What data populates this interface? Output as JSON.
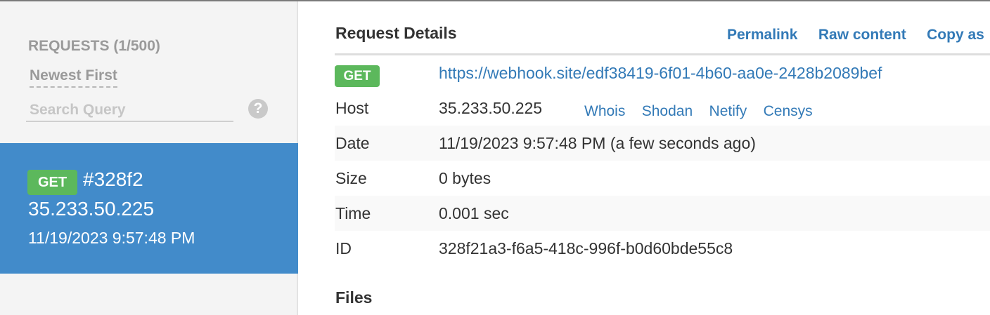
{
  "sidebar": {
    "header": "REQUESTS (1/500)",
    "sort_label": "Newest First",
    "search_placeholder": "Search Query",
    "help_glyph": "?",
    "selected_request": {
      "method": "GET",
      "id_short": "#328f2",
      "ip": "35.233.50.225",
      "date": "11/19/2023 9:57:48 PM"
    }
  },
  "main": {
    "title": "Request Details",
    "actions": [
      "Permalink",
      "Raw content",
      "Copy as"
    ],
    "method": "GET",
    "url": "https://webhook.site/edf38419-6f01-4b60-aa0e-2428b2089bef",
    "host_label": "Host",
    "host_value": "35.233.50.225",
    "host_links": [
      "Whois",
      "Shodan",
      "Netify",
      "Censys"
    ],
    "date_label": "Date",
    "date_value": "11/19/2023 9:57:48 PM (a few seconds ago)",
    "size_label": "Size",
    "size_value": "0 bytes",
    "time_label": "Time",
    "time_value": "0.001 sec",
    "id_label": "ID",
    "id_value": "328f21a3-f6a5-418c-996f-b0d60bde55c8",
    "files_title": "Files"
  },
  "colors": {
    "selected_bg": "#428bca",
    "badge_green": "#5cb85c",
    "link_blue": "#337ab7",
    "sidebar_bg": "#f4f4f4"
  }
}
